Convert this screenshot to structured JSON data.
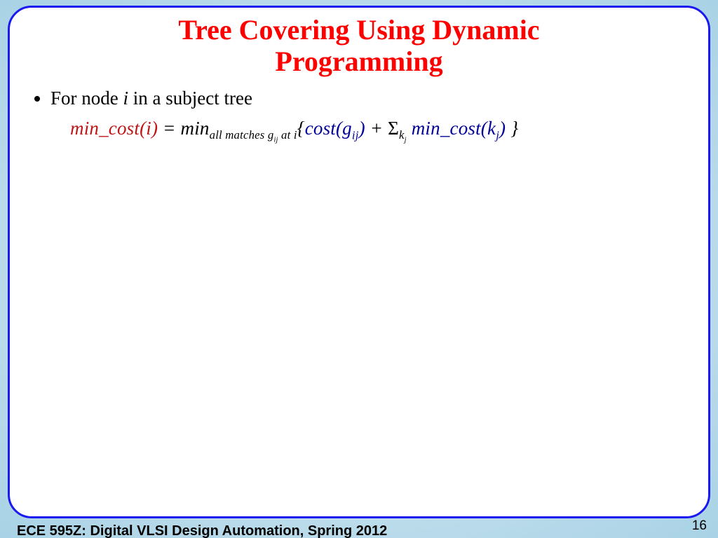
{
  "title_line1": "Tree Covering Using Dynamic",
  "title_line2": "Programming",
  "bullet": {
    "pre": "For node ",
    "i": "i",
    "post": " in a subject tree"
  },
  "eq": {
    "lhs_mincost": "min_cost(i)",
    "equals": " = ",
    "min": "min",
    "min_sub": "all matches g",
    "min_sub_ij": "ij",
    "min_sub_at_i": " at i",
    "lbrace": "{",
    "cost": "cost(g",
    "cost_ij": "ij",
    "cost_close": ")",
    "plus": " + ",
    "sigma": "Σ",
    "sigma_sub": "k",
    "sigma_sub_j": "j",
    "space": " ",
    "mc_k": "min_cost(k",
    "mc_j": "j",
    "mc_close": ")",
    "rbrace": " }"
  },
  "footer": "ECE 595Z: Digital VLSI Design Automation, Spring 2012",
  "page_number": "16"
}
